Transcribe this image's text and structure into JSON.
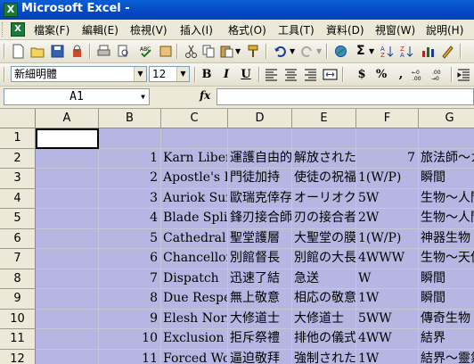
{
  "window": {
    "title": "Microsoft Excel -"
  },
  "menu": [
    "檔案(F)",
    "編輯(E)",
    "檢視(V)",
    "插入(I)",
    "格式(O)",
    "工具(T)",
    "資料(D)",
    "視窗(W)",
    "說明(H)"
  ],
  "format_toolbar": {
    "font": "新細明體",
    "size": "12",
    "bold": "B",
    "italic": "I",
    "underline": "U",
    "currency": "$",
    "percent": "%",
    "comma": ","
  },
  "formula_bar": {
    "name_box": "A1",
    "fx": "fx",
    "content": ""
  },
  "columns": [
    "A",
    "B",
    "C",
    "D",
    "E",
    "F",
    "G"
  ],
  "rows": [
    {
      "num": "1",
      "cells": [
        "",
        "",
        "",
        "",
        "",
        "",
        ""
      ]
    },
    {
      "num": "2",
      "cells": [
        "",
        "1",
        "Karn Liberated",
        "運護自由的",
        "解放されたカーン",
        "7",
        "旅法師～カーン"
      ]
    },
    {
      "num": "3",
      "cells": [
        "",
        "2",
        "Apostle's Blessing",
        "門徒加持",
        "使徒の祝福",
        "1(W/P)",
        "瞬間"
      ]
    },
    {
      "num": "4",
      "cells": [
        "",
        "3",
        "Auriok Sunchaser",
        "歐瑞克倖存者",
        "オーリオクの太陽追い",
        "5W",
        "生物～人間"
      ]
    },
    {
      "num": "5",
      "cells": [
        "",
        "4",
        "Blade Splicer",
        "鋒刃接合師",
        "刃の接合者",
        "2W",
        "生物～人間"
      ]
    },
    {
      "num": "6",
      "cells": [
        "",
        "5",
        "Cathedral Membrane",
        "聖堂護層",
        "大聖堂の膜",
        "1(W/P)",
        "神器生物"
      ]
    },
    {
      "num": "7",
      "cells": [
        "",
        "6",
        "Chancellor of the Annex",
        "別館督長",
        "別館の大長",
        "4WWW",
        "生物～天使"
      ]
    },
    {
      "num": "8",
      "cells": [
        "",
        "7",
        "Dispatch",
        "迅速了結",
        "急送",
        "W",
        "瞬間"
      ]
    },
    {
      "num": "9",
      "cells": [
        "",
        "8",
        "Due Respect",
        "無上敬意",
        "相応の敬意",
        "1W",
        "瞬間"
      ]
    },
    {
      "num": "10",
      "cells": [
        "",
        "9",
        "Elesh Norn, Grand Cenobite",
        "大修道士",
        "大修道士",
        "5WW",
        "傳奇生物"
      ]
    },
    {
      "num": "11",
      "cells": [
        "",
        "10",
        "Exclusion Ritual",
        "拒斥祭禮",
        "排他の儀式",
        "4WW",
        "結界"
      ]
    },
    {
      "num": "12",
      "cells": [
        "",
        "11",
        "Forced Worship",
        "逼迫敬拜",
        "強制された崇拝",
        "1W",
        "結界～靈氣"
      ]
    }
  ]
}
